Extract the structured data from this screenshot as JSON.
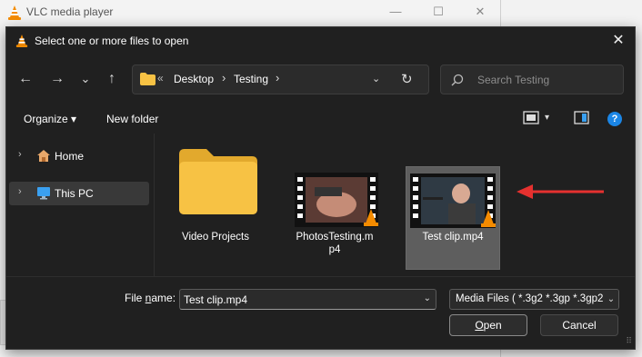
{
  "vlc_window": {
    "title": "VLC media player",
    "controls": {
      "minimize": "—",
      "maximize": "☐",
      "close": "✕"
    }
  },
  "dialog": {
    "title": "Select one or more files to open",
    "close_glyph": "✕"
  },
  "nav": {
    "back": "←",
    "forward": "→",
    "recent": "⌄",
    "up": "↑"
  },
  "address_bar": {
    "overflow": "«",
    "crumbs": [
      "Desktop",
      "Testing"
    ],
    "separator": "›",
    "dropdown": "⌄",
    "refresh": "↻"
  },
  "search": {
    "placeholder": "Search Testing"
  },
  "command_bar": {
    "organize": "Organize ▾",
    "new_folder": "New folder",
    "view_dropdown": "▾",
    "help": "?"
  },
  "nav_pane": {
    "items": [
      {
        "label": "Home",
        "icon": "home-icon",
        "expander": "›"
      },
      {
        "label": "This PC",
        "icon": "pc-icon",
        "expander": "›",
        "selected": true
      }
    ]
  },
  "files": [
    {
      "name": "Video Projects",
      "type": "folder"
    },
    {
      "name_line1": "PhotosTesting.m",
      "name_line2": "p4",
      "type": "video"
    },
    {
      "name": "Test clip.mp4",
      "type": "video",
      "selected": true
    }
  ],
  "bottom": {
    "file_name_label_pre": "File ",
    "file_name_label_u": "n",
    "file_name_label_post": "ame:",
    "file_name_value": "Test clip.mp4",
    "file_name_dropdown": "⌄",
    "file_type_value": "Media Files ( *.3g2 *.3gp *.3gp2",
    "file_type_dropdown": "⌄",
    "open_pre": "",
    "open_u": "O",
    "open_post": "pen",
    "cancel": "Cancel",
    "grip": "⠿"
  },
  "colors": {
    "dialog_bg": "#202020",
    "selection": "#5e5e5e",
    "accent_blue": "#1b86e6",
    "arrow_red": "#e5312f",
    "folder_yellow": "#f7c244"
  }
}
